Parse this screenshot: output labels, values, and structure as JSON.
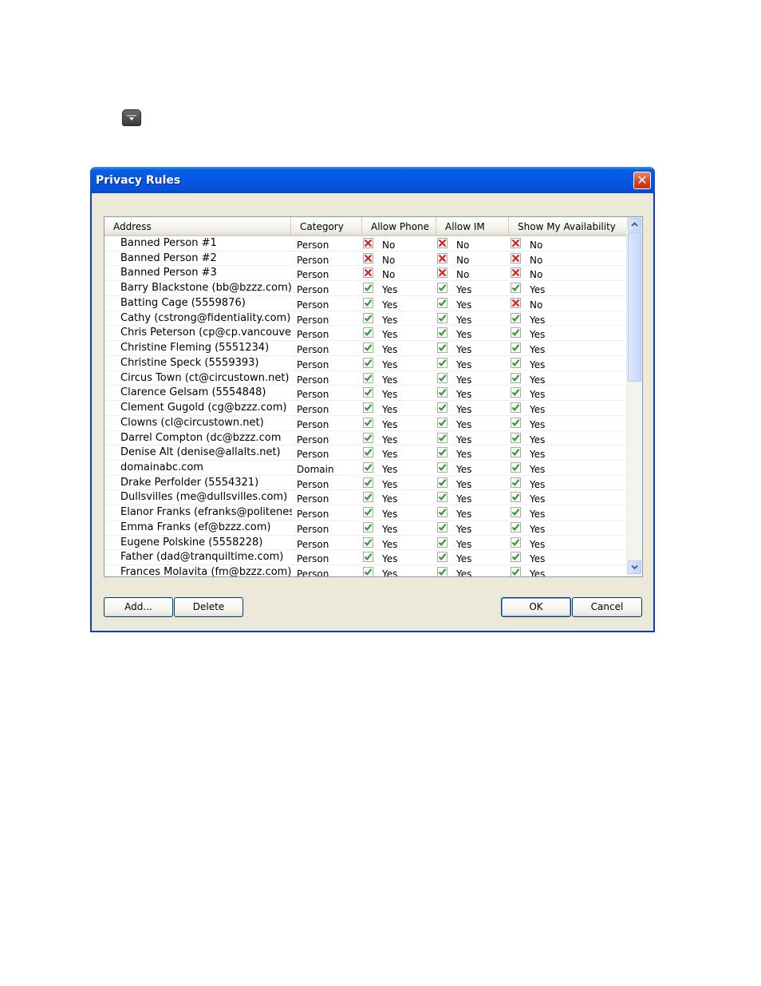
{
  "dialog": {
    "title": "Privacy Rules",
    "close_icon": "close-icon"
  },
  "columns": [
    "Address",
    "Category",
    "Allow Phone",
    "Allow IM",
    "Show My Availability"
  ],
  "rows": [
    {
      "address": "Banned Person #1",
      "category": "Person",
      "phone": "No",
      "im": "No",
      "avail": "No"
    },
    {
      "address": "Banned Person #2",
      "category": "Person",
      "phone": "No",
      "im": "No",
      "avail": "No"
    },
    {
      "address": "Banned Person #3",
      "category": "Person",
      "phone": "No",
      "im": "No",
      "avail": "No"
    },
    {
      "address": "Barry Blackstone (bb@bzzz.com)",
      "category": "Person",
      "phone": "Yes",
      "im": "Yes",
      "avail": "Yes"
    },
    {
      "address": "Batting Cage (5559876)",
      "category": "Person",
      "phone": "Yes",
      "im": "Yes",
      "avail": "No"
    },
    {
      "address": "Cathy (cstrong@fidentiality.com)",
      "category": "Person",
      "phone": "Yes",
      "im": "Yes",
      "avail": "Yes"
    },
    {
      "address": "Chris Peterson (cp@cp.vancouveri",
      "category": "Person",
      "phone": "Yes",
      "im": "Yes",
      "avail": "Yes"
    },
    {
      "address": "Christine Fleming (5551234)",
      "category": "Person",
      "phone": "Yes",
      "im": "Yes",
      "avail": "Yes"
    },
    {
      "address": "Christine Speck (5559393)",
      "category": "Person",
      "phone": "Yes",
      "im": "Yes",
      "avail": "Yes"
    },
    {
      "address": "Circus Town (ct@circustown.net)",
      "category": "Person",
      "phone": "Yes",
      "im": "Yes",
      "avail": "Yes"
    },
    {
      "address": "Clarence Gelsam (5554848)",
      "category": "Person",
      "phone": "Yes",
      "im": "Yes",
      "avail": "Yes"
    },
    {
      "address": "Clement Gugold (cg@bzzz.com)",
      "category": "Person",
      "phone": "Yes",
      "im": "Yes",
      "avail": "Yes"
    },
    {
      "address": "Clowns (cl@circustown.net)",
      "category": "Person",
      "phone": "Yes",
      "im": "Yes",
      "avail": "Yes"
    },
    {
      "address": "Darrel Compton (dc@bzzz.com",
      "category": "Person",
      "phone": "Yes",
      "im": "Yes",
      "avail": "Yes"
    },
    {
      "address": "Denise Alt (denise@allalts.net)",
      "category": "Person",
      "phone": "Yes",
      "im": "Yes",
      "avail": "Yes"
    },
    {
      "address": "domainabc.com",
      "category": "Domain",
      "phone": "Yes",
      "im": "Yes",
      "avail": "Yes"
    },
    {
      "address": "Drake Perfolder (5554321)",
      "category": "Person",
      "phone": "Yes",
      "im": "Yes",
      "avail": "Yes"
    },
    {
      "address": "Dullsvilles (me@dullsvilles.com)",
      "category": "Person",
      "phone": "Yes",
      "im": "Yes",
      "avail": "Yes"
    },
    {
      "address": "Elanor Franks (efranks@politeness",
      "category": "Person",
      "phone": "Yes",
      "im": "Yes",
      "avail": "Yes"
    },
    {
      "address": "Emma Franks (ef@bzzz.com)",
      "category": "Person",
      "phone": "Yes",
      "im": "Yes",
      "avail": "Yes"
    },
    {
      "address": "Eugene Polskine (5558228)",
      "category": "Person",
      "phone": "Yes",
      "im": "Yes",
      "avail": "Yes"
    },
    {
      "address": "Father (dad@tranquiltime.com)",
      "category": "Person",
      "phone": "Yes",
      "im": "Yes",
      "avail": "Yes"
    },
    {
      "address": "Frances Molavita (fm@bzzz.com)",
      "category": "Person",
      "phone": "Yes",
      "im": "Yes",
      "avail": "Yes"
    }
  ],
  "buttons": {
    "add": "Add...",
    "delete": "Delete",
    "ok": "OK",
    "cancel": "Cancel"
  },
  "colors": {
    "titlebar": "#0058e6",
    "allow": "#2f9a2f",
    "deny": "#d8201a"
  }
}
